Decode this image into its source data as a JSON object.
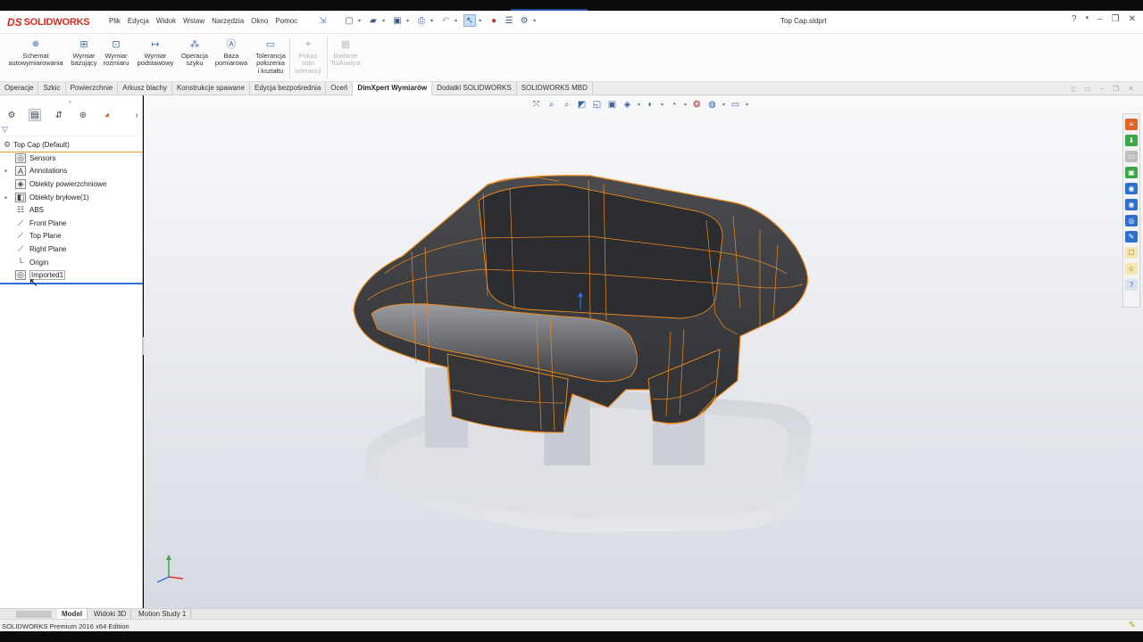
{
  "app": {
    "logo_ds": "DS",
    "logo_name": "SOLIDWORKS",
    "document_title": "Top Cap.sldprt"
  },
  "menu": [
    "Plik",
    "Edycja",
    "Widok",
    "Wstaw",
    "Narzędzia",
    "Okno",
    "Pomoc"
  ],
  "commands": [
    {
      "label": "Schemat autowymiarowania",
      "lines": [
        "Schemat",
        "autowymiarowania"
      ],
      "icon": "auto-dimension-scheme-icon",
      "enabled": true
    },
    {
      "label": "Wymiar bazujący",
      "lines": [
        "Wymiar",
        "bazujący"
      ],
      "icon": "datum-dimension-icon",
      "enabled": true
    },
    {
      "label": "Wymiar rozmiaru",
      "lines": [
        "Wymiar",
        "rozmiaru"
      ],
      "icon": "size-dimension-icon",
      "enabled": true
    },
    {
      "label": "Wymiar podstawowy",
      "lines": [
        "Wymiar",
        "podstawowy"
      ],
      "icon": "basic-dimension-icon",
      "enabled": true
    },
    {
      "label": "Operacja szyku",
      "lines": [
        "Operacja",
        "szyku"
      ],
      "icon": "pattern-feature-icon",
      "enabled": true
    },
    {
      "label": "Baza pomiarowa",
      "lines": [
        "Baza",
        "pomiarowa"
      ],
      "icon": "datum-icon",
      "enabled": true
    },
    {
      "label": "Tolerancja położenia i kształtu",
      "lines": [
        "Tolerancja",
        "położenia",
        "i kształtu"
      ],
      "icon": "geometric-tolerance-icon",
      "enabled": true
    },
    {
      "label": "Pokaż stan tolerancji",
      "lines": [
        "Pokaż",
        "stan",
        "tolerancji"
      ],
      "icon": "show-tolerance-status-icon",
      "enabled": false
    },
    {
      "label": "Badanie TolAnalyst",
      "lines": [
        "Badanie",
        "TolAnalyst"
      ],
      "icon": "tolanalyst-icon",
      "enabled": false
    }
  ],
  "tabs": [
    {
      "label": "Operacje",
      "active": false
    },
    {
      "label": "Szkic",
      "active": false
    },
    {
      "label": "Powierzchnie",
      "active": false
    },
    {
      "label": "Arkusz blachy",
      "active": false
    },
    {
      "label": "Konstrukcje spawane",
      "active": false
    },
    {
      "label": "Edycja bezpośrednia",
      "active": false
    },
    {
      "label": "Oceń",
      "active": false
    },
    {
      "label": "DimXpert Wymiarów",
      "active": true
    },
    {
      "label": "Dodatki SOLIDWORKS",
      "active": false
    },
    {
      "label": "SOLIDWORKS MBD",
      "active": false
    }
  ],
  "tree": {
    "root_label": "Top Cap  (Default)",
    "items": [
      {
        "label": "Sensors",
        "icon": "sensors-icon",
        "expandable": false
      },
      {
        "label": "Annotations",
        "icon": "annotations-icon",
        "expandable": true
      },
      {
        "label": "Obiekty powierzchniowe",
        "icon": "surface-bodies-icon",
        "expandable": false
      },
      {
        "label": "Obiekty bryłowe(1)",
        "icon": "solid-bodies-icon",
        "expandable": true
      },
      {
        "label": "ABS",
        "icon": "material-icon",
        "expandable": false
      },
      {
        "label": "Front Plane",
        "icon": "plane-icon",
        "expandable": false
      },
      {
        "label": "Top Plane",
        "icon": "plane-icon",
        "expandable": false
      },
      {
        "label": "Right Plane",
        "icon": "plane-icon",
        "expandable": false
      },
      {
        "label": "Origin",
        "icon": "origin-icon",
        "expandable": false
      },
      {
        "label": "Imported1",
        "icon": "imported-feature-icon",
        "expandable": false,
        "selected": true
      }
    ]
  },
  "bottom_tabs": [
    {
      "label": "Model",
      "active": true
    },
    {
      "label": "Widoki 3D",
      "active": false
    },
    {
      "label": "Motion Study 1",
      "active": false
    }
  ],
  "status": {
    "text": "SOLIDWORKS Premium 2016 x64 Edition"
  },
  "colors": {
    "accent_orange": "#f08a1c",
    "model_body": "#3a3b3e",
    "selection_blue": "#2a6ed6",
    "brand_red": "#d42a1e"
  }
}
